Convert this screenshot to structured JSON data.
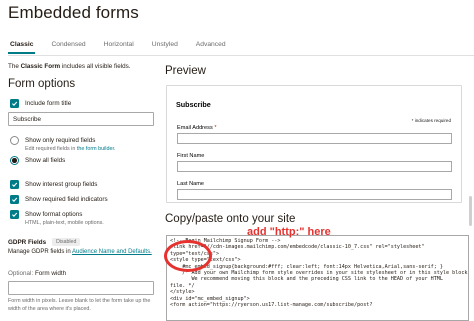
{
  "page_title": "Embedded forms",
  "tabs": [
    {
      "label": "Classic",
      "active": true
    },
    {
      "label": "Condensed",
      "active": false
    },
    {
      "label": "Horizontal",
      "active": false
    },
    {
      "label": "Unstyled",
      "active": false
    },
    {
      "label": "Advanced",
      "active": false
    }
  ],
  "intro": {
    "bold": "Classic Form",
    "prefix": "The",
    "suffix": "includes all visible fields."
  },
  "form_options": {
    "heading": "Form options",
    "include_title_label": "Include form title",
    "title_value": "Subscribe",
    "show_required_label": "Show only required fields",
    "show_required_help_prefix": "Edit required fields in",
    "show_required_help_link": "the form builder.",
    "show_all_label": "Show all fields",
    "interest_groups_label": "Show interest group fields",
    "required_indicators_label": "Show required field indicators",
    "format_options_label": "Show format options",
    "format_options_help": "HTML, plain-text, mobile options."
  },
  "gdpr": {
    "title": "GDPR Fields",
    "badge": "Disabled",
    "desc_prefix": "Manage GDPR fields in",
    "desc_link": "Audience Name and Defaults."
  },
  "form_width": {
    "optional": "Optional:",
    "label": "Form width",
    "help": "Form width in pixels. Leave blank to let the form take up the width of the area where it's placed."
  },
  "preview": {
    "heading": "Preview",
    "form_title": "Subscribe",
    "required_note": "* indicates required",
    "fields": [
      {
        "label": "Email Address",
        "required": true
      },
      {
        "label": "First Name",
        "required": false
      },
      {
        "label": "Last Name",
        "required": false
      }
    ]
  },
  "copy_paste": {
    "heading": "Copy/paste onto your site",
    "code_lines": [
      "<!-- Begin Mailchimp Signup Form -->",
      "<link href=\"//cdn-images.mailchimp.com/embedcode/classic-10_7.css\" rel=\"stylesheet\"",
      "type=\"text/css\">",
      "<style type=\"text/css\">",
      "    #mc_embed_signup{background:#fff; clear:left; font:14px Helvetica,Arial,sans-serif; }",
      "    /* Add your own Mailchimp form style overrides in your site stylesheet or in this style block.",
      "       We recommend moving this block and the preceding CSS link to the HEAD of your HTML",
      "file. */",
      "</style>",
      "<div id=\"mc_embed_signup\">",
      "<form action=\"https://ryerson.us17.list-manage.com/subscribe/post?"
    ]
  },
  "annotation": {
    "text": "add \"http:\" here",
    "color": "#e6322f"
  },
  "colors": {
    "accent": "#007c89",
    "text": "#241c15",
    "annotation": "#e6322f"
  }
}
